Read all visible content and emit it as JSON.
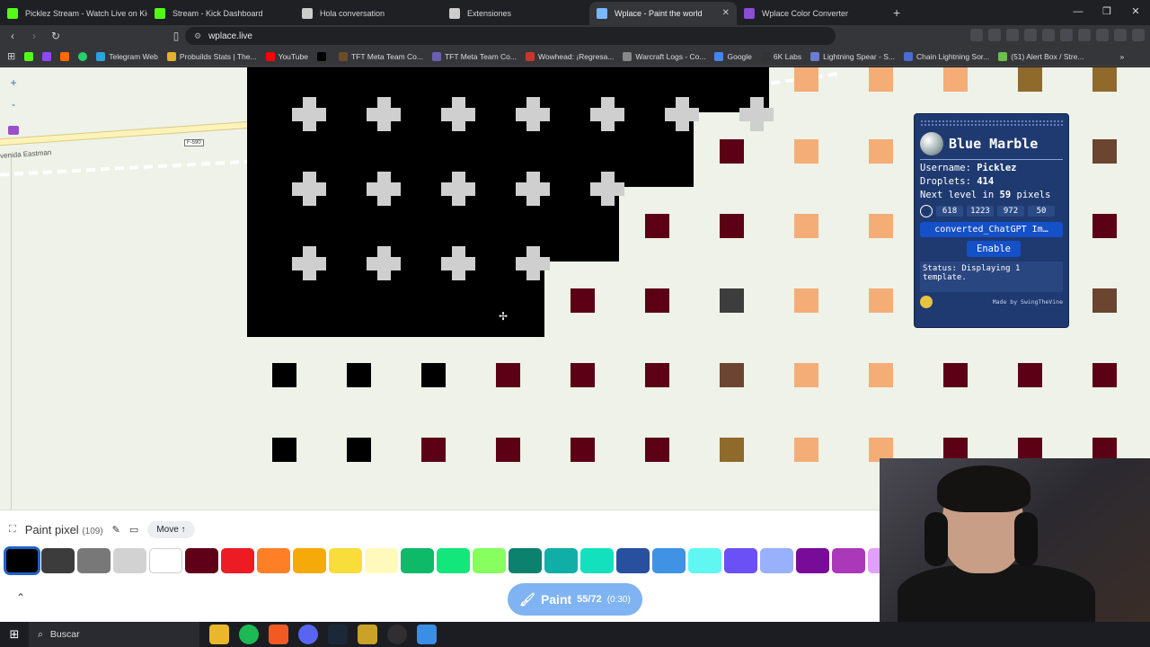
{
  "tabs": [
    {
      "title": "Picklez Stream - Watch Live on Kick",
      "icon": "kick-icon",
      "color": "#53fc18",
      "active": false
    },
    {
      "title": "Stream - Kick Dashboard",
      "icon": "kick-icon",
      "color": "#53fc18",
      "active": false
    },
    {
      "title": "Hola conversation",
      "icon": "chat-icon",
      "color": "#cccccc",
      "active": false
    },
    {
      "title": "Extensiones",
      "icon": "puzzle-icon",
      "color": "#cccccc",
      "active": false
    },
    {
      "title": "Wplace - Paint the world",
      "icon": "wplace-icon",
      "color": "#7ab8ff",
      "active": true
    },
    {
      "title": "Wplace Color Converter",
      "icon": "palette-icon",
      "color": "#8a4dd6",
      "active": false
    }
  ],
  "address": {
    "url": "wplace.live"
  },
  "bookmarks": [
    {
      "label": "Telegram Web",
      "color": "#2aa3de"
    },
    {
      "label": "Probuilds Stats | The...",
      "color": "#e5b02a"
    },
    {
      "label": "YouTube",
      "color": "#ff0000"
    },
    {
      "label": "",
      "color": "#000000"
    },
    {
      "label": "TFT Meta Team Co...",
      "color": "#6c4b2a"
    },
    {
      "label": "TFT Meta Team Co...",
      "color": "#6a5fb0"
    },
    {
      "label": "Wowhead: ¡Regresa...",
      "color": "#c6362a"
    },
    {
      "label": "Warcraft Logs - Co...",
      "color": "#888888"
    },
    {
      "label": "Google",
      "color": "#4285f4"
    },
    {
      "label": "6K Labs",
      "color": "#333333"
    },
    {
      "label": "Lightning Spear - S...",
      "color": "#6d7bd0"
    },
    {
      "label": "Chain Lightning Sor...",
      "color": "#4a6bd0"
    },
    {
      "label": "(51) Alert Box / Stre...",
      "color": "#6ac04a"
    }
  ],
  "map": {
    "road_label": "venida Eastman",
    "shield_label": "F-590"
  },
  "blue_marble": {
    "title": "Blue Marble",
    "username_label": "Username:",
    "username": "Picklez",
    "droplets_label": "Droplets:",
    "droplets": "414",
    "next_level_prefix": "Next level in",
    "next_level_value": "59",
    "next_level_suffix": "pixels",
    "coords": [
      "618",
      "1223",
      "972",
      "50"
    ],
    "template_file": "converted_ChatGPT Im…",
    "enable_label": "Enable",
    "status": "Status: Displaying 1 template.",
    "credit": "Made by SwingTheVine"
  },
  "paint": {
    "label": "Paint pixel",
    "count": "(109)",
    "move_label": "Move ↑",
    "button_label": "Paint",
    "button_progress": "55/72",
    "button_timer": "(0:30)"
  },
  "palette": [
    "#000000",
    "#3c3c3c",
    "#787878",
    "#d2d2d2",
    "#ffffff",
    "#600018",
    "#ed1c24",
    "#ff7f27",
    "#f6aa09",
    "#f9dd3b",
    "#fffabc",
    "#0eb968",
    "#13e67b",
    "#87ff5e",
    "#0c816e",
    "#10aea6",
    "#13e1be",
    "#28509e",
    "#4093e4",
    "#60f7f2",
    "#6b50f6",
    "#99b1fb",
    "#780c99",
    "#aa38b9",
    "#e09ff9"
  ],
  "taskbar": {
    "search_placeholder": "Buscar"
  }
}
